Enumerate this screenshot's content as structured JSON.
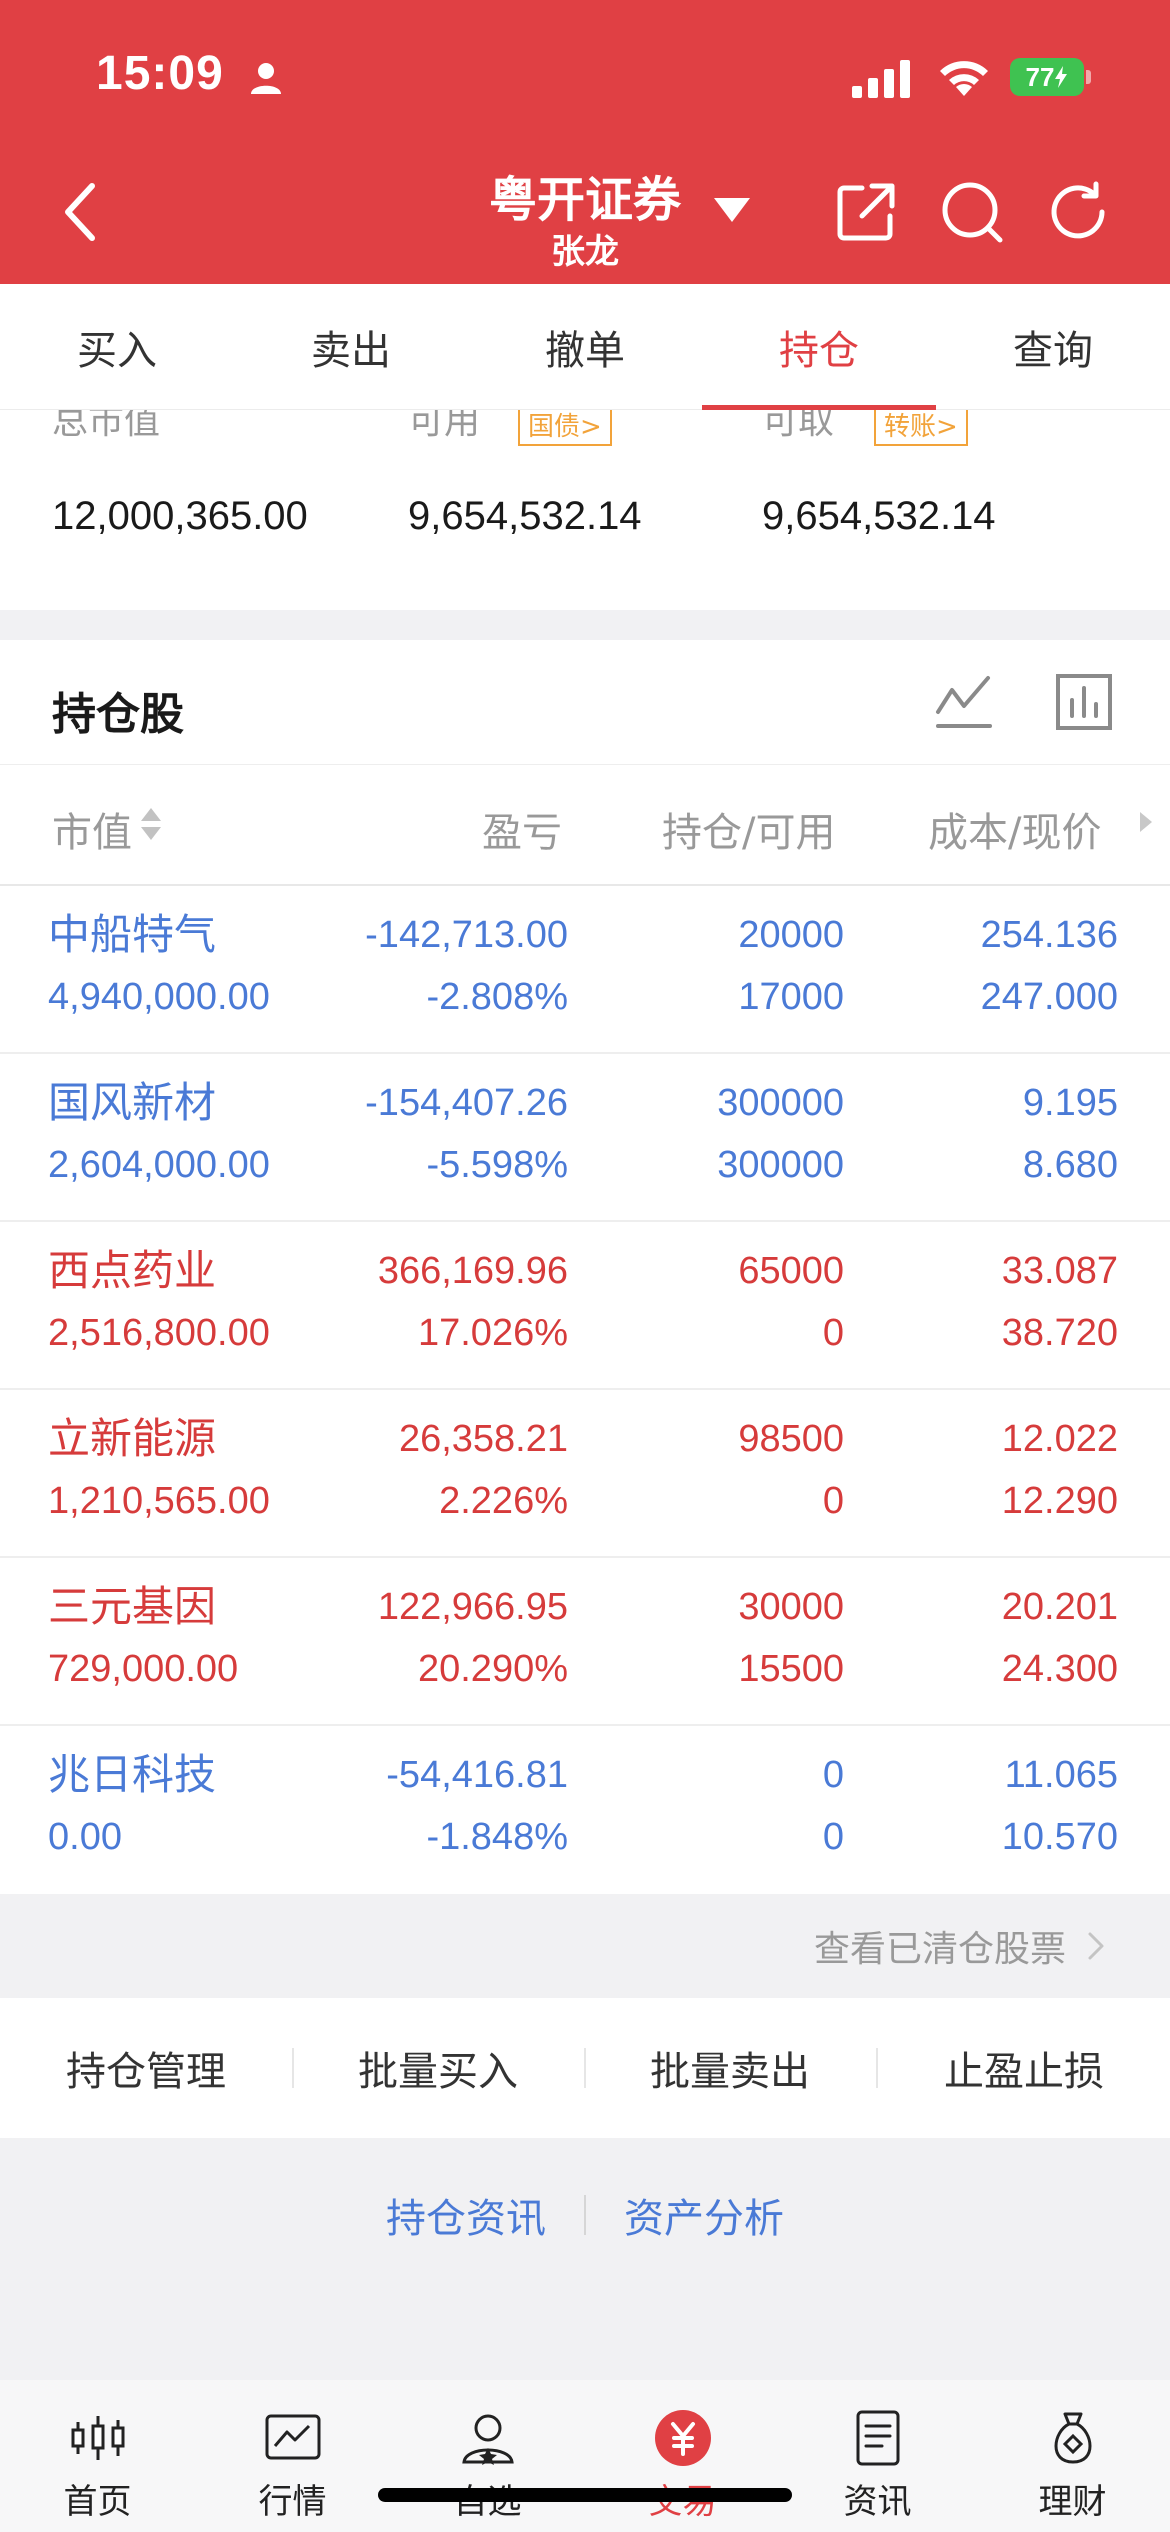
{
  "status_bar": {
    "time": "15:09",
    "battery": "77"
  },
  "header": {
    "broker": "粤开证券",
    "account": "张龙"
  },
  "tabs": [
    {
      "label": "买入"
    },
    {
      "label": "卖出"
    },
    {
      "label": "撤单"
    },
    {
      "label": "持仓"
    },
    {
      "label": "查询"
    }
  ],
  "active_tab": "持仓",
  "summary": {
    "total_label": "总市值",
    "total_value": "12,000,365.00",
    "available_label": "可用",
    "available_tag": "国债",
    "available_value": "9,654,532.14",
    "withdrawable_label": "可取",
    "withdrawable_tag": "转账",
    "withdrawable_value": "9,654,532.14"
  },
  "holdings": {
    "title": "持仓股",
    "columns": [
      "市值",
      "盈亏",
      "持仓/可用",
      "成本/现价"
    ],
    "rows": [
      {
        "name": "中船特气",
        "market_value": "4,940,000.00",
        "pnl": "-142,713.00",
        "pnl_pct": "-2.808%",
        "position": "20000",
        "available": "17000",
        "cost": "254.136",
        "price": "247.000",
        "trend": "down"
      },
      {
        "name": "国风新材",
        "market_value": "2,604,000.00",
        "pnl": "-154,407.26",
        "pnl_pct": "-5.598%",
        "position": "300000",
        "available": "300000",
        "cost": "9.195",
        "price": "8.680",
        "trend": "down"
      },
      {
        "name": "西点药业",
        "market_value": "2,516,800.00",
        "pnl": "366,169.96",
        "pnl_pct": "17.026%",
        "position": "65000",
        "available": "0",
        "cost": "33.087",
        "price": "38.720",
        "trend": "up"
      },
      {
        "name": "立新能源",
        "market_value": "1,210,565.00",
        "pnl": "26,358.21",
        "pnl_pct": "2.226%",
        "position": "98500",
        "available": "0",
        "cost": "12.022",
        "price": "12.290",
        "trend": "up"
      },
      {
        "name": "三元基因",
        "market_value": "729,000.00",
        "pnl": "122,966.95",
        "pnl_pct": "20.290%",
        "position": "30000",
        "available": "15500",
        "cost": "20.201",
        "price": "24.300",
        "trend": "up"
      },
      {
        "name": "兆日科技",
        "market_value": "0.00",
        "pnl": "-54,416.81",
        "pnl_pct": "-1.848%",
        "position": "0",
        "available": "0",
        "cost": "11.065",
        "price": "10.570",
        "trend": "down"
      }
    ],
    "cleared_link": "查看已清仓股票"
  },
  "actions": [
    "持仓管理",
    "批量买入",
    "批量卖出",
    "止盈止损"
  ],
  "links": [
    "持仓资讯",
    "资产分析"
  ],
  "bottom_nav": [
    {
      "label": "首页",
      "icon": "candlestick-icon"
    },
    {
      "label": "行情",
      "icon": "chart-icon"
    },
    {
      "label": "自选",
      "icon": "user-star-icon"
    },
    {
      "label": "交易",
      "icon": "yuan-icon"
    },
    {
      "label": "资讯",
      "icon": "document-icon"
    },
    {
      "label": "理财",
      "icon": "money-bag-icon"
    }
  ],
  "colors": {
    "brand_red": "#e04044",
    "up": "#d63b3b",
    "down": "#4a7ad6",
    "tag": "#f2a33a"
  }
}
